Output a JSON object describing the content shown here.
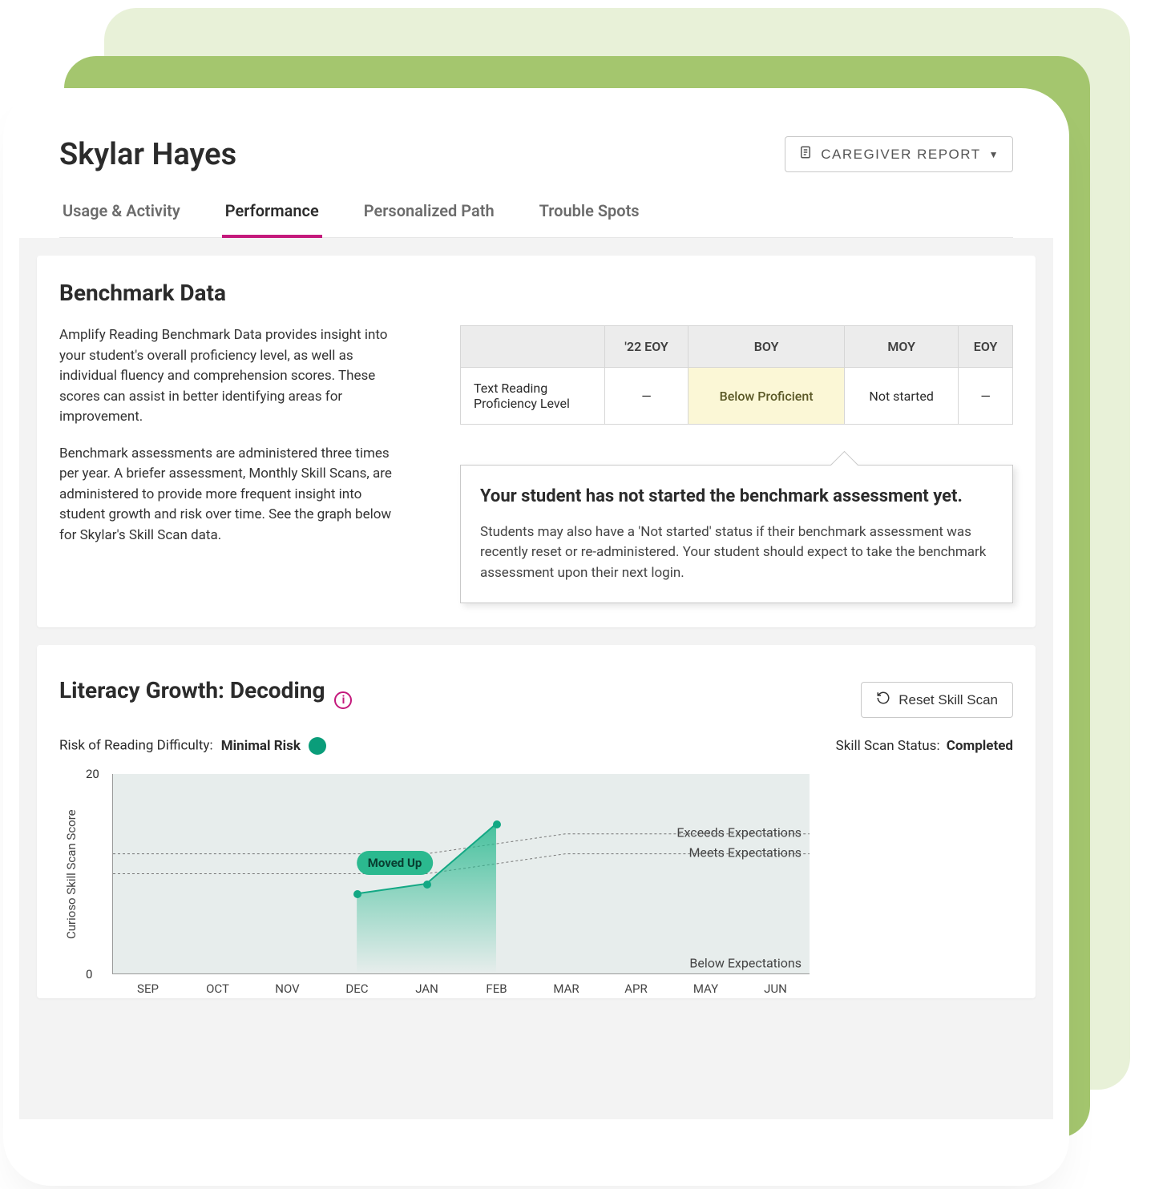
{
  "student_name": "Skylar Hayes",
  "report_button": "CAREGIVER REPORT",
  "tabs": [
    "Usage & Activity",
    "Performance",
    "Personalized Path",
    "Trouble Spots"
  ],
  "active_tab_index": 1,
  "benchmark": {
    "title": "Benchmark Data",
    "para1": "Amplify Reading Benchmark Data provides insight into your student's overall proficiency level, as well as individual fluency and comprehension scores. These scores can assist in better identifying areas for improvement.",
    "para2": "Benchmark assessments are administered three times per year. A briefer assessment, Monthly Skill Scans, are administered to provide more frequent insight into student growth and risk over time. See the graph below for Skylar's Skill Scan data.",
    "columns": [
      "'22 EOY",
      "BOY",
      "MOY",
      "EOY"
    ],
    "row_label": "Text Reading Proficiency Level",
    "cells": [
      "—",
      "Below Proficient",
      "Not started",
      "—"
    ],
    "callout_title": "Your student has not started the benchmark assessment yet.",
    "callout_body": "Students may also have a 'Not started' status if their benchmark assessment was recently reset or re-administered. Your student should expect to take the benchmark assessment upon their next login."
  },
  "literacy": {
    "title": "Literacy Growth: Decoding",
    "reset": "Reset Skill Scan",
    "risk_label": "Risk of Reading Difficulty:",
    "risk_value": "Minimal Risk",
    "status_label": "Skill Scan Status:",
    "status_value": "Completed",
    "moved_up": "Moved Up"
  },
  "chart_data": {
    "type": "line",
    "ylabel": "Curioso Skill Scan Score",
    "ylim": [
      0,
      20
    ],
    "yticks": [
      0,
      20
    ],
    "categories": [
      "SEP",
      "OCT",
      "NOV",
      "DEC",
      "JAN",
      "FEB",
      "MAR",
      "APR",
      "MAY",
      "JUN"
    ],
    "series": [
      {
        "name": "Score",
        "values": [
          null,
          null,
          null,
          8,
          9,
          15,
          null,
          null,
          null,
          null
        ]
      }
    ],
    "bands": [
      {
        "label": "Exceeds Expectations",
        "y_start": 12,
        "y_end": 14
      },
      {
        "label": "Meets Expectations",
        "y_start": 10,
        "y_end": 12
      },
      {
        "label": "Below Expectations",
        "y_start": 0,
        "y_end": 1
      }
    ],
    "annotation": {
      "text": "Moved Up",
      "x_index": 4,
      "y": 10
    }
  }
}
